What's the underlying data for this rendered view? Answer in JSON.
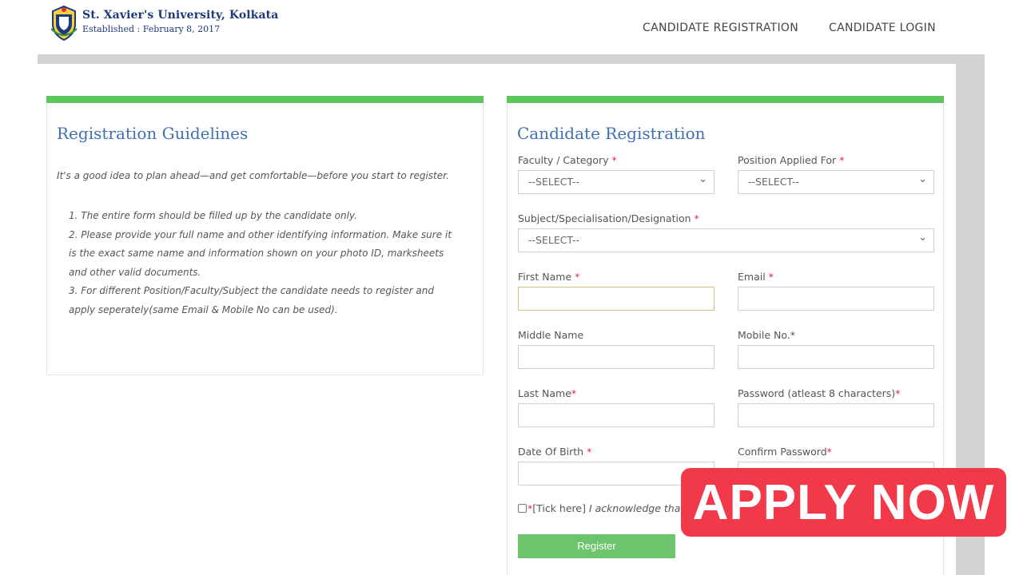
{
  "header": {
    "brand_name": "St. Xavier's University, Kolkata",
    "brand_established": "Established : February 8, 2017",
    "nav": {
      "registration": "CANDIDATE REGISTRATION",
      "login": "CANDIDATE LOGIN"
    }
  },
  "guidelines": {
    "title": "Registration Guidelines",
    "intro": "It's a good idea to plan ahead—and get comfortable—before you start to register.",
    "items": [
      "1. The entire form should be filled up by the candidate only.",
      "2. Please provide your full name and other identifying information. Make sure it is the exact same name and information shown on your photo ID, marksheets and other valid documents.",
      "3. For different Position/Faculty/Subject the candidate needs to register and apply seperately(same Email & Mobile No can be used)."
    ]
  },
  "form": {
    "title": "Candidate Registration",
    "required_mark": "*",
    "faculty": {
      "label": "Faculty / Category",
      "value": "--SELECT--"
    },
    "position": {
      "label": "Position Applied For",
      "value": "--SELECT--"
    },
    "subject": {
      "label": "Subject/Specialisation/Designation",
      "value": "--SELECT--"
    },
    "first_name": {
      "label": "First Name",
      "value": ""
    },
    "email": {
      "label": "Email",
      "value": ""
    },
    "middle_name": {
      "label": "Middle Name",
      "value": ""
    },
    "mobile": {
      "label": "Mobile No.",
      "value": ""
    },
    "last_name": {
      "label": "Last Name",
      "value": ""
    },
    "password": {
      "label": "Password (atleast 8 characters)",
      "value": ""
    },
    "dob": {
      "label": "Date Of Birth",
      "value": ""
    },
    "confirm_password": {
      "label": "Confirm Password",
      "value": ""
    },
    "acknowledge": {
      "tick": "[Tick here]",
      "text": "I acknowledge that a"
    },
    "register_label": "Register"
  },
  "overlay": {
    "apply_now": "APPLY NOW"
  },
  "colors": {
    "accent_green": "#5cc55c",
    "title_blue": "#3f6fb5",
    "required_red": "#e0254a",
    "apply_red": "#f2394a"
  }
}
